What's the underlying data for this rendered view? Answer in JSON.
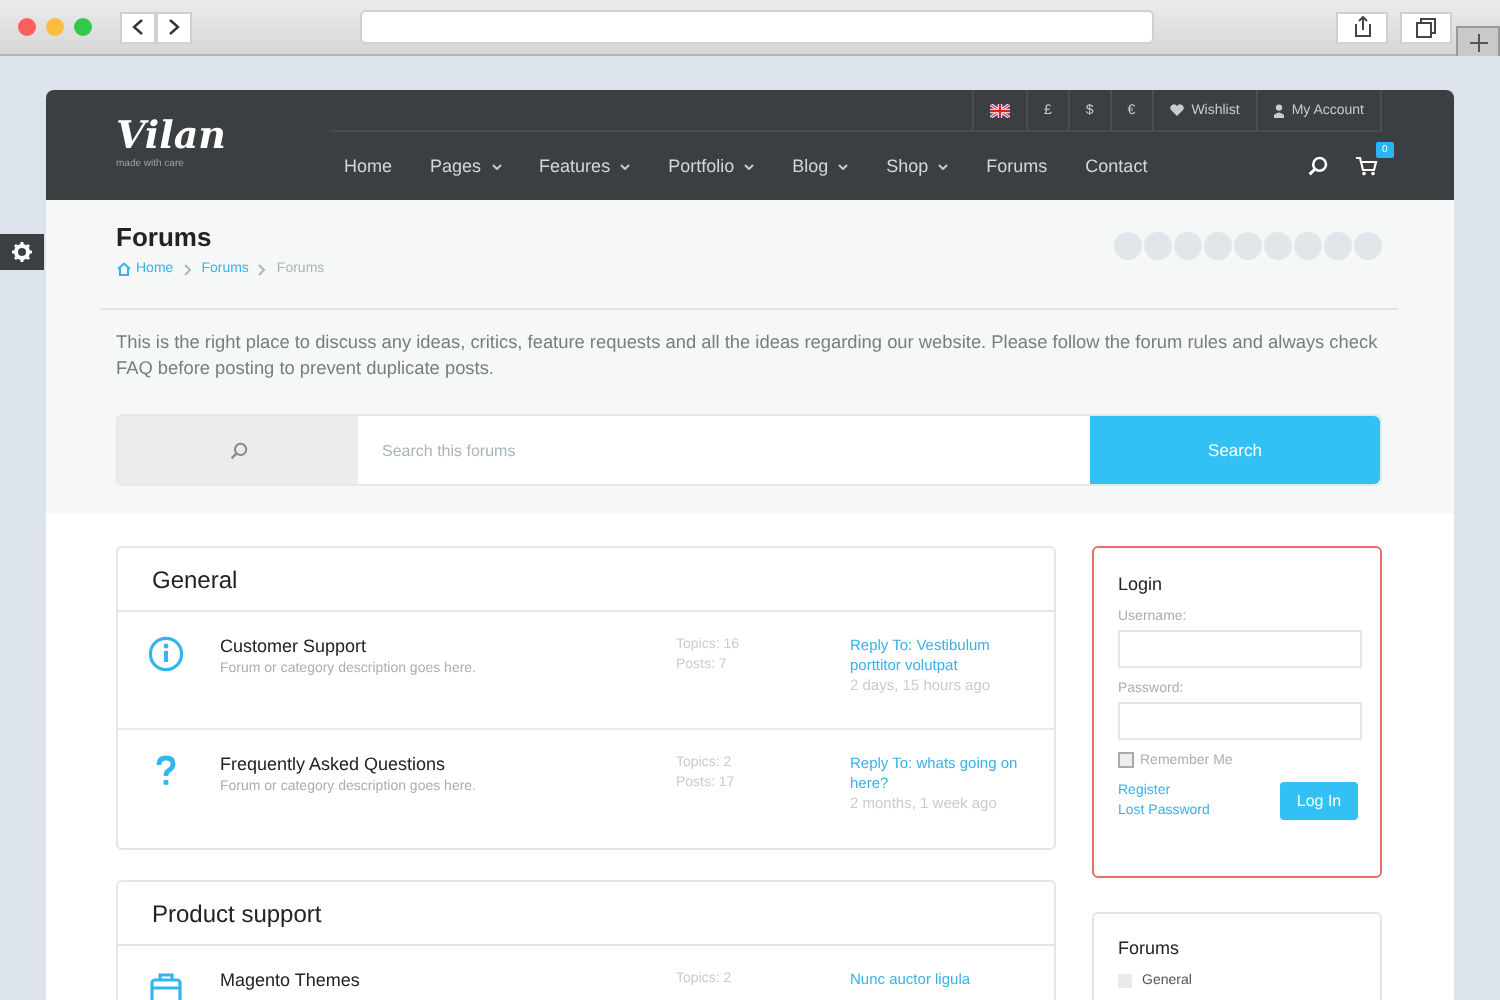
{
  "header": {
    "logo": {
      "name": "Vilan",
      "tagline": "made with care"
    },
    "topbar": [
      {
        "kind": "flag"
      },
      {
        "kind": "text",
        "label": "£"
      },
      {
        "kind": "text",
        "label": "$"
      },
      {
        "kind": "text",
        "label": "€"
      },
      {
        "kind": "heart",
        "label": "Wishlist"
      },
      {
        "kind": "user",
        "label": "My Account"
      }
    ],
    "nav": [
      {
        "label": "Home",
        "dropdown": false
      },
      {
        "label": "Pages",
        "dropdown": true
      },
      {
        "label": "Features",
        "dropdown": true
      },
      {
        "label": "Portfolio",
        "dropdown": true
      },
      {
        "label": "Blog",
        "dropdown": true
      },
      {
        "label": "Shop",
        "dropdown": true
      },
      {
        "label": "Forums",
        "dropdown": false
      },
      {
        "label": "Contact",
        "dropdown": false
      }
    ],
    "cart_count": "0"
  },
  "page_title": "Forums",
  "breadcrumb": [
    {
      "label": "Home",
      "current": false
    },
    {
      "label": "Forums",
      "current": false
    },
    {
      "label": "Forums",
      "current": true
    }
  ],
  "intro": "This is the right place to discuss any ideas, critics, feature requests and all the ideas regarding our website. Please follow the forum rules and always check FAQ before posting to prevent duplicate posts.",
  "search": {
    "placeholder": "Search this forums",
    "button": "Search"
  },
  "categories": [
    {
      "title": "General",
      "forums": [
        {
          "kind": "info",
          "name": "Customer Support",
          "description": "Forum or category description goes here.",
          "topics": "Topics: 16",
          "posts": "Posts: 7",
          "last_reply": "Reply To: Vestibulum porttitor volutpat",
          "time": "2 days, 15 hours ago"
        },
        {
          "kind": "question",
          "name": "Frequently Asked Questions",
          "description": "Forum or category description goes here.",
          "topics": "Topics: 2",
          "posts": "Posts: 17",
          "last_reply": "Reply To: whats going on here?",
          "time": "2 months, 1 week ago"
        }
      ]
    },
    {
      "title": "Product support",
      "forums": [
        {
          "kind": "bag",
          "name": "Magento Themes",
          "topics": "Topics: 2",
          "last_reply": "Nunc auctor ligula"
        }
      ]
    }
  ],
  "login": {
    "title": "Login",
    "username_label": "Username:",
    "password_label": "Password:",
    "remember": {
      "label": "Remember Me",
      "checked": false
    },
    "register": "Register",
    "lost_password": "Lost Password",
    "button": "Log In"
  },
  "forums_widget": {
    "title": "Forums",
    "items": [
      {
        "label": "General"
      }
    ]
  }
}
